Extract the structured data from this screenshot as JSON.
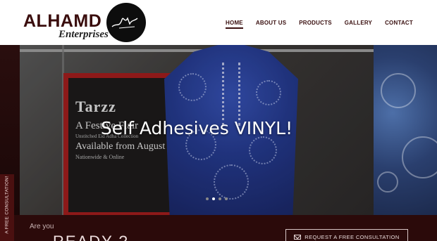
{
  "brand": {
    "name": "ALHAMD",
    "subtitle": "Enterprises",
    "emblem_icon": "signature-emblem-icon"
  },
  "nav": {
    "items": [
      {
        "label": "HOME",
        "active": true
      },
      {
        "label": "ABOUT US",
        "active": false
      },
      {
        "label": "PRODUCTS",
        "active": false
      },
      {
        "label": "GALLERY",
        "active": false
      },
      {
        "label": "CONTACT",
        "active": false
      }
    ]
  },
  "hero": {
    "title": "Self Adhesives VINYL!",
    "poster": {
      "brand": "Tarzz",
      "headline": "A Festive Flair",
      "subline": "Unstitched Eid Adha Collection",
      "date_line": "Available from August 4",
      "availability": "Nationwide & Online"
    },
    "slides_count": 4,
    "active_slide": 2
  },
  "cta_band": {
    "lead": "Are you",
    "headline": "READY ?",
    "button_label": "REQUEST A FREE CONSULTATION",
    "button_icon": "envelope-icon"
  },
  "side_tab": {
    "label": "A FREE CONSULTATION!"
  },
  "colors": {
    "brand_dark": "#2b0a0a",
    "nav_text": "#3a1010",
    "poster_frame": "#a11d1d",
    "dress_blue": "#24398c"
  }
}
